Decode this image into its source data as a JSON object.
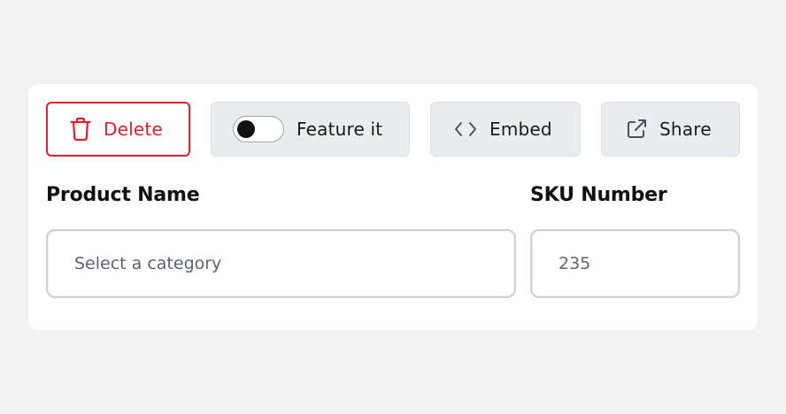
{
  "toolbar": {
    "delete_label": "Delete",
    "feature_label": "Feature it",
    "feature_toggle_on": false,
    "embed_label": "Embed",
    "share_label": "Share"
  },
  "fields": {
    "product_name_label": "Product Name",
    "product_name_placeholder": "Select a category",
    "sku_label": "SKU Number",
    "sku_placeholder": "235"
  },
  "icons": {
    "delete": "trash-icon",
    "embed": "code-icon",
    "share": "external-link-icon"
  },
  "colors": {
    "danger": "#e0202e",
    "button_gray": "#ebecee",
    "background": "#f2f2f2"
  }
}
